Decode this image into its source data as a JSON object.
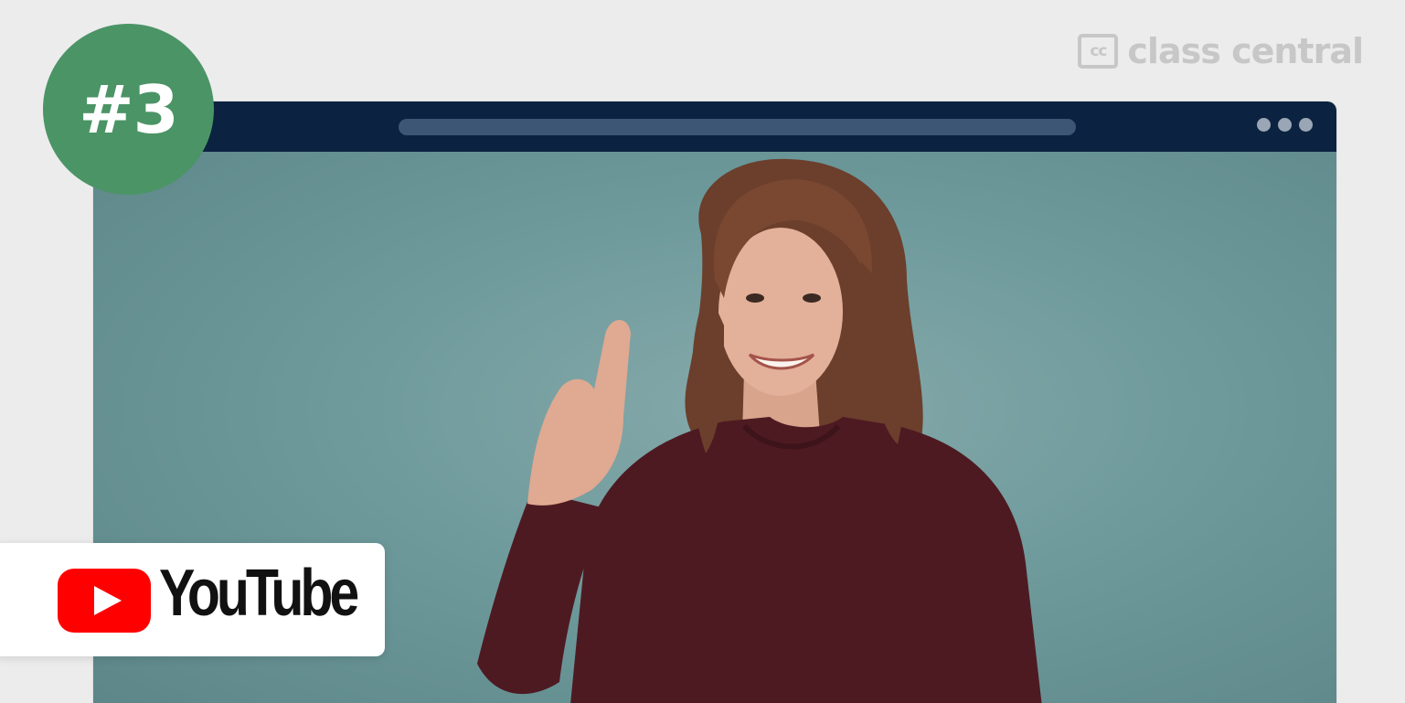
{
  "rank": {
    "label": "#3",
    "color": "#4b9466"
  },
  "brand": {
    "logo_box_text": "cc",
    "logo_text": "class central",
    "color": "#c7c7c7"
  },
  "browser": {
    "titlebar_color": "#0b2340",
    "video_background": "#7aa0a2"
  },
  "platform": {
    "name": "YouTube",
    "icon": "youtube-play-icon",
    "icon_color": "#ff0000"
  }
}
